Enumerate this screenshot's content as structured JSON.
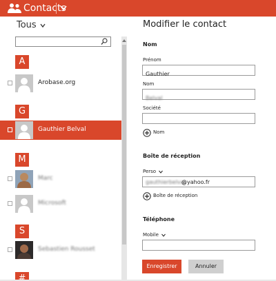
{
  "header": {
    "app_title": "Contacts",
    "accent": "#d9472b",
    "icons": [
      "people-icon",
      "chevron-down-icon"
    ]
  },
  "sidebar": {
    "filter_label": "Tous",
    "search": {
      "placeholder": "",
      "value": ""
    },
    "groups": [
      {
        "letter": "A",
        "contacts": [
          {
            "name": "Arobase.org",
            "avatar": "placeholder",
            "selected": false,
            "blurred": false
          }
        ]
      },
      {
        "letter": "G",
        "contacts": [
          {
            "name": "Gauthier Belval",
            "avatar": "placeholder",
            "selected": true,
            "blurred": false
          }
        ]
      },
      {
        "letter": "M",
        "contacts": [
          {
            "name": "Marc",
            "avatar": "photo",
            "selected": false,
            "blurred": true
          },
          {
            "name": "Microsoft",
            "avatar": "placeholder",
            "selected": false,
            "blurred": true
          }
        ]
      },
      {
        "letter": "S",
        "contacts": [
          {
            "name": "Sebastien Rousset",
            "avatar": "photo",
            "selected": false,
            "blurred": true
          }
        ]
      },
      {
        "letter": "#",
        "contacts": []
      }
    ]
  },
  "form": {
    "title": "Modifier le contact",
    "name_section": {
      "title": "Nom",
      "first_name_label": "Prénom",
      "first_name_value": "Gauthier",
      "last_name_label": "Nom",
      "last_name_value": "Belval",
      "company_label": "Société",
      "company_value": "",
      "add_label": "Nom"
    },
    "email_section": {
      "title": "Boîte de réception",
      "type_label": "Perso",
      "email_user": "gauthierbelval",
      "email_domain": "@yahoo.fr",
      "add_label": "Boîte de réception"
    },
    "phone_section": {
      "title": "Téléphone",
      "type_label": "Mobile",
      "value": ""
    },
    "save_label": "Enregistrer",
    "cancel_label": "Annuler"
  }
}
